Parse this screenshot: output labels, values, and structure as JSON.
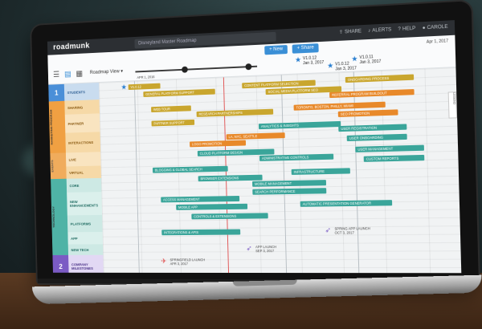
{
  "colors": {
    "gold": "#c9a62e",
    "orange": "#e8892a",
    "teal": "#3aa59a",
    "blue_lane": "#4a8fd8",
    "purple_lane": "#7b5bc4",
    "orange_lane": "#f0a042",
    "teal_lane": "#4fb3a6"
  },
  "app": {
    "logo": "roadmunk",
    "roadmap_name": "Disneyland Master Roadmap",
    "btn_new": "+ New",
    "btn_share": "+ Share",
    "top_icons": [
      {
        "icon": "share-icon",
        "label": "SHARE"
      },
      {
        "icon": "bell-icon",
        "label": "ALERTS"
      },
      {
        "icon": "help-icon",
        "label": "HELP"
      },
      {
        "icon": "user-icon",
        "label": "CAROLE"
      }
    ],
    "date_right": "Apr 1, 2017",
    "filter_label": "Roadmap View ▾"
  },
  "timeline_milestones": [
    {
      "name": "V1.0.12",
      "date": "Jan 3, 2017"
    },
    {
      "name": "V1.0.12",
      "date": "Jan 3, 2017"
    },
    {
      "name": "V1.0.11",
      "date": "Jan 3, 2017"
    },
    {
      "name": "V1.0.12",
      "date": "Jan 3, 2017"
    }
  ],
  "top_date_label": "Apr 1, 2016",
  "lanes": [
    {
      "number": "1",
      "color": "#4a8fd8",
      "subs": [
        "STUDENTS"
      ]
    },
    {
      "number": "",
      "color": "#f0a042",
      "group": "MARKETING PROGRAM",
      "subs": [
        "SHARING",
        "PARTNER",
        "INTERACTIONS"
      ]
    },
    {
      "number": "",
      "color": "#f0a042",
      "group": "EVENTS",
      "subs": [
        "LIVE",
        "VIRTUAL"
      ]
    },
    {
      "number": "",
      "color": "#4fb3a6",
      "group": "TECHNOLOGY",
      "subs": [
        "CORE",
        "NEW ENHANCEMENTS",
        "PLATFORMS",
        "APP",
        "NEW TECH"
      ]
    },
    {
      "number": "2",
      "color": "#7b5bc4",
      "subs": [
        "COMPANY MILESTONES"
      ]
    }
  ],
  "items": [
    {
      "label": "V1.0.12",
      "type": "gold"
    },
    {
      "label": "GENERAL PLATFORM SUPPORT",
      "type": "gold"
    },
    {
      "label": "CONTENT PLATFORM SELECTION",
      "type": "gold"
    },
    {
      "label": "SOCIAL MEDIA PLATFORM SEO",
      "type": "gold"
    },
    {
      "label": "ONBOARDING PROCESS",
      "type": "gold"
    },
    {
      "label": "REFERRAL PROGRAM BUILDOUT",
      "type": "orange"
    },
    {
      "label": "WEB TOUR",
      "type": "gold"
    },
    {
      "label": "RESEARCH PARTNERSHIPS",
      "type": "gold"
    },
    {
      "label": "PARTNER SUPPORT",
      "type": "gold"
    },
    {
      "label": "TORONTO, BOSTON, PHILLY, MIAMI",
      "type": "orange"
    },
    {
      "label": "SEO PROMOTION",
      "type": "orange"
    },
    {
      "label": "ANALYTICS & INSIGHTS",
      "type": "teal"
    },
    {
      "label": "USER REGISTRATION",
      "type": "teal"
    },
    {
      "label": "LA, NYC, SEATTLE",
      "type": "orange"
    },
    {
      "label": "LOGO PROMOTION",
      "type": "orange"
    },
    {
      "label": "USER ONBOARDING",
      "type": "teal"
    },
    {
      "label": "CLOUD PLATFORM DESIGN",
      "type": "teal"
    },
    {
      "label": "ADMINISTRATIVE CONTROLS",
      "type": "teal"
    },
    {
      "label": "USER MANAGEMENT",
      "type": "teal"
    },
    {
      "label": "CUSTOM REPORTS",
      "type": "teal"
    },
    {
      "label": "BLOGGING & GLOBAL SEARCH",
      "type": "teal"
    },
    {
      "label": "BROWSER EXTENSIONS",
      "type": "teal"
    },
    {
      "label": "INFRASTRUCTURE",
      "type": "teal"
    },
    {
      "label": "MOBILE MANAGEMENT",
      "type": "teal"
    },
    {
      "label": "SEARCH PERFORMANCE",
      "type": "teal"
    },
    {
      "label": "ACCESS MANAGEMENT",
      "type": "teal"
    },
    {
      "label": "MOBILE APP",
      "type": "teal"
    },
    {
      "label": "CONTROLS & EXTENSIONS",
      "type": "teal"
    },
    {
      "label": "AUTOMATIC PRESENTATION GENERATOR",
      "type": "teal"
    },
    {
      "label": "INTEGRATIONS & APIS",
      "type": "teal"
    }
  ],
  "milestones": [
    {
      "icon": "plane-icon",
      "label": "SPRINGFIELD LAUNCH",
      "sub": "Apr 3, 2017"
    },
    {
      "icon": "rocket-icon",
      "label": "APP LAUNCH",
      "sub": "Sep 3, 2017"
    },
    {
      "icon": "rocket-icon",
      "label": "SPRING APP LAUNCH",
      "sub": "Oct 3, 2017"
    }
  ],
  "side_tab": "LEGEND"
}
